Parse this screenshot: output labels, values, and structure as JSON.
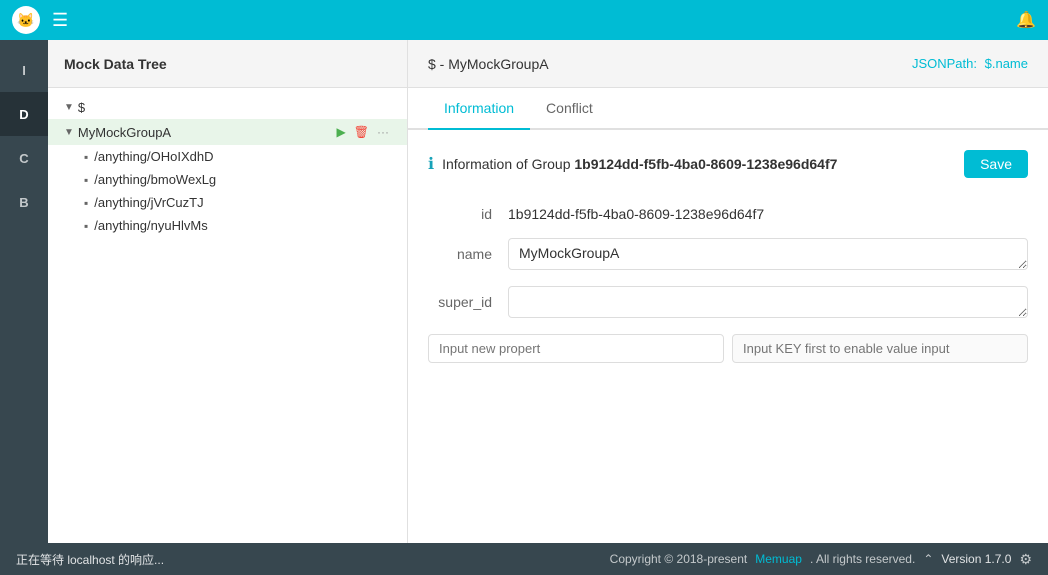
{
  "topbar": {
    "logo_text": "🐱",
    "bell_label": "🔔"
  },
  "sidebar": {
    "items": [
      {
        "label": "I",
        "active": false
      },
      {
        "label": "D",
        "active": true
      },
      {
        "label": "C",
        "active": false
      },
      {
        "label": "B",
        "active": false
      }
    ]
  },
  "tree": {
    "title": "Mock Data Tree",
    "root": "$",
    "group": {
      "name": "MyMockGroupA",
      "id": "MyMockGroupA"
    },
    "children": [
      {
        "path": "/anything/OHoIXdhD"
      },
      {
        "path": "/anything/bmoWexLg"
      },
      {
        "path": "/anything/jVrCuzTJ"
      },
      {
        "path": "/anything/nyuHlvMs"
      }
    ]
  },
  "content": {
    "header_path": "$ - MyMockGroupA",
    "jsonpath_label": "JSONPath:",
    "jsonpath_value": "$.name",
    "tabs": [
      {
        "label": "Information",
        "active": true
      },
      {
        "label": "Conflict",
        "active": false
      }
    ],
    "info_prefix": "Information of Group",
    "group_id": "1b9124dd-f5fb-4ba0-8609-1238e96d64f7",
    "save_label": "Save",
    "fields": {
      "id_label": "id",
      "id_value": "1b9124dd-f5fb-4ba0-8609-1238e96d64f7",
      "name_label": "name",
      "name_value": "MyMockGroupA",
      "super_id_label": "super_id",
      "super_id_value": ""
    },
    "new_property": {
      "key_placeholder": "Input new propert",
      "value_placeholder": "Input KEY first to enable value input"
    }
  },
  "footer": {
    "status": "正在等待 localhost 的响应...",
    "copyright": "Copyright © 2018-present",
    "brand": "Memuар",
    "rights": ". All rights reserved.",
    "version_label": "Version 1.7.0",
    "gear_icon": "⚙"
  }
}
